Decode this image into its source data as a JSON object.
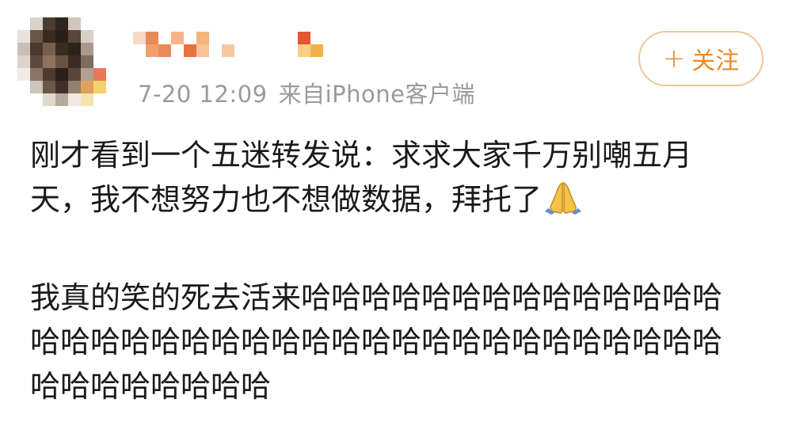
{
  "post": {
    "time": "7-20 12:09",
    "source": "来自iPhone客户端",
    "follow_label": "关注",
    "follow_icon": "+",
    "paragraph1_line1": "刚才看到一个五迷转发说：求求大家千万别嘲五月",
    "paragraph1_line2": "天，我不想努力也不想做数据，拜托了",
    "paragraph2_line1": "我真的笑的死去活来哈哈哈哈哈哈哈哈哈哈哈哈哈哈",
    "paragraph2_line2": "哈哈哈哈哈哈哈哈哈哈哈哈哈哈哈哈哈哈哈哈哈哈哈",
    "paragraph2_line3": "哈哈哈哈哈哈哈哈",
    "emoji": "folded-hands-icon"
  },
  "colors": {
    "accent": "#e98a26",
    "follow_border": "#f0c79a",
    "meta_text": "#9a9a9a",
    "body_text": "#1a1a1a"
  }
}
